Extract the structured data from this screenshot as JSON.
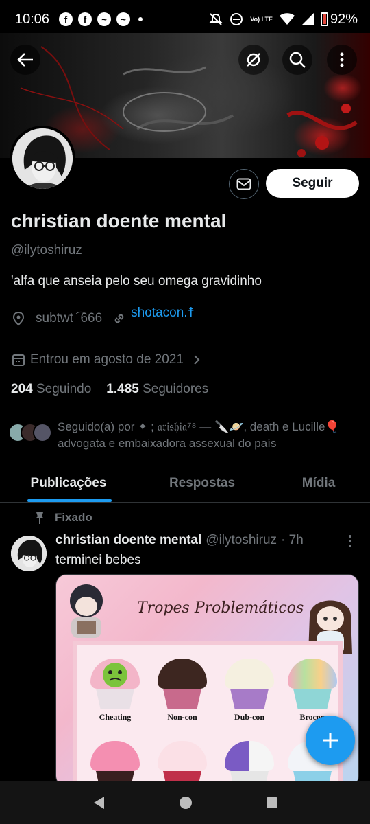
{
  "status_bar": {
    "time": "10:06",
    "battery": "92%",
    "network_label": "Vo) LTE"
  },
  "profile": {
    "name": "christian doente mental",
    "handle": "@ilytoshiruz",
    "bio": "ꞌalfa que anseia pelo seu omega gravidinho",
    "location": "subtwt ͡ 666",
    "website": "shotacon.☨",
    "joined": "Entrou em agosto de 2021",
    "following_count": "204",
    "following_label": "Seguindo",
    "followers_count": "1.485",
    "followers_label": "Seguidores",
    "followed_by": "Seguido(a) por ✦ ; 𝔞𝔯𝔦𝔰𝔥𝔦𝔞⁷⁸ — 🔪🪐, death e Lucille🎈advogata e embaixadora assexual do país",
    "follow_button": "Seguir"
  },
  "tabs": [
    {
      "label": "Publicações",
      "active": true
    },
    {
      "label": "Respostas",
      "active": false
    },
    {
      "label": "Mídia",
      "active": false
    }
  ],
  "post": {
    "pinned_label": "Fixado",
    "author_name": "christian doente mental",
    "author_handle": "@ilytoshiruz",
    "time": "· 7h",
    "text": "terminei bebes",
    "media": {
      "title": "Tropes Problemáticos",
      "items": [
        "Cheating",
        "Non-con",
        "Dub-con",
        "Brocon"
      ]
    }
  },
  "icons": {
    "back": "back-arrow-icon",
    "hide": "eye-slash-icon",
    "search": "search-icon",
    "more": "more-vertical-icon",
    "message": "mail-icon",
    "location": "location-pin-icon",
    "link": "link-icon",
    "calendar": "calendar-icon",
    "pin": "pin-icon",
    "compose": "plus-icon"
  },
  "colors": {
    "accent": "#1d9bf0",
    "muted": "#71767b",
    "text": "#e7e9ea",
    "background": "#000000"
  }
}
